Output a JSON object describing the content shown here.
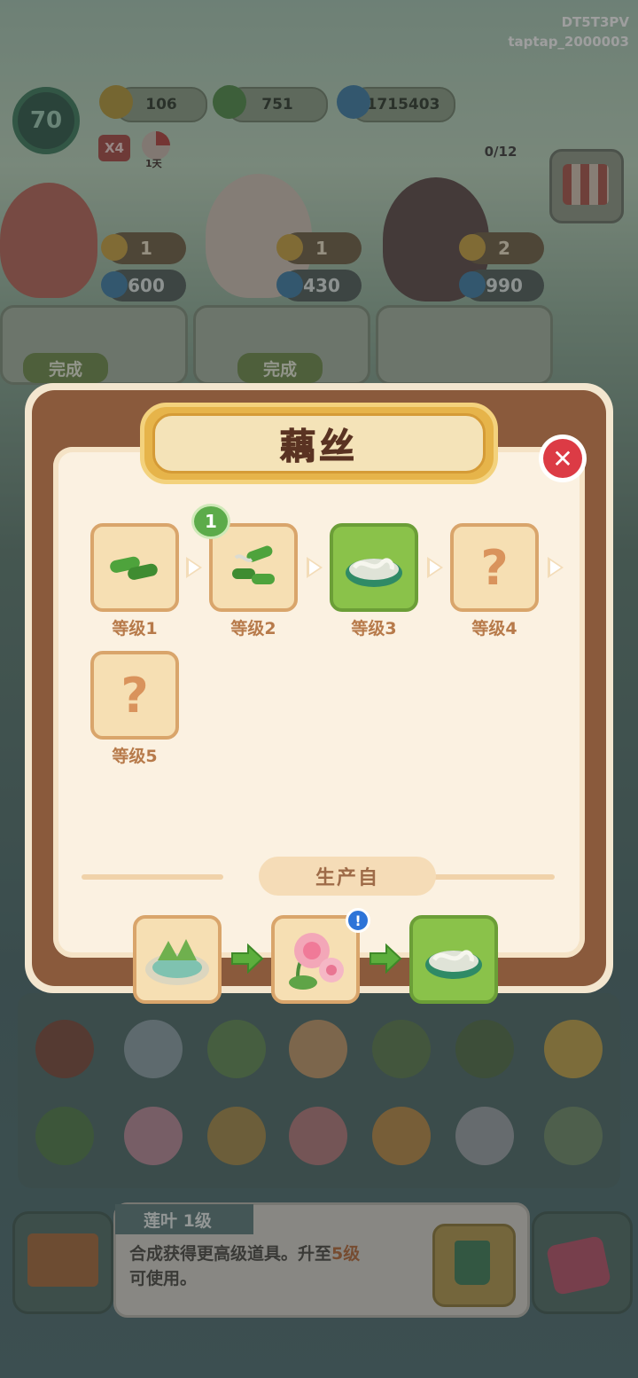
{
  "watermark": {
    "line1": "DT5T3PV",
    "line2": "taptap_2000003"
  },
  "hud": {
    "level": "70",
    "energy": "106",
    "coins": "751",
    "gems": "1715403",
    "multiplier": "X4",
    "timer_label": "1天",
    "customer_count": "0/12"
  },
  "customers": [
    {
      "stars": "1",
      "reward": "600",
      "status": "完成"
    },
    {
      "stars": "1",
      "reward": "430",
      "status": "完成"
    },
    {
      "stars": "2",
      "reward": "990"
    }
  ],
  "modal": {
    "title": "藕丝",
    "close_icon": "close-icon",
    "chain": [
      {
        "label": "等级1",
        "icon": "lotus-root-icon"
      },
      {
        "label": "等级2",
        "icon": "lotus-root-slice-icon",
        "badge": "1"
      },
      {
        "label": "等级3",
        "icon": "lotus-silk-bowl-icon",
        "active": true
      },
      {
        "label": "等级4",
        "icon": "unknown-icon",
        "unknown": "?"
      },
      {
        "label": "等级5",
        "icon": "unknown-icon",
        "unknown": "?"
      }
    ],
    "produced_from_label": "生产自",
    "production": [
      {
        "icon": "lotus-pond-icon"
      },
      {
        "icon": "lotus-flower-icon",
        "alert": "!"
      },
      {
        "icon": "lotus-silk-bowl-icon",
        "active": true
      }
    ]
  },
  "bottom": {
    "item_name": "莲叶 1级",
    "description_part1": "合成获得更高级道具。升至",
    "description_highlight": "5级",
    "description_part2": "可使用。"
  },
  "colors": {
    "modal_frame": "#8a5a3c",
    "active_tile": "#8ac24a",
    "close_red": "#dc3b45",
    "banner_gold": "#e6b44a"
  }
}
